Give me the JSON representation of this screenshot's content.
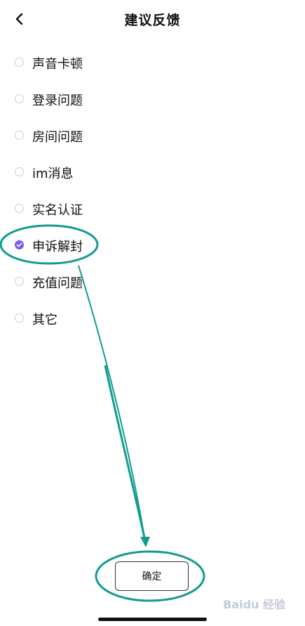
{
  "header": {
    "title": "建议反馈"
  },
  "options": [
    {
      "label": "声音卡顿",
      "checked": false
    },
    {
      "label": "登录问题",
      "checked": false
    },
    {
      "label": "房间问题",
      "checked": false
    },
    {
      "label": "im消息",
      "checked": false
    },
    {
      "label": "实名认证",
      "checked": false
    },
    {
      "label": "申诉解封",
      "checked": true
    },
    {
      "label": "充值问题",
      "checked": false
    },
    {
      "label": "其它",
      "checked": false
    }
  ],
  "confirm_label": "确定",
  "colors": {
    "accent": "#7b5cf0",
    "annotation": "#139b8f"
  },
  "icons": {
    "back": "chevron-left-icon",
    "check": "check-icon"
  },
  "watermark": "Baidu 经验"
}
